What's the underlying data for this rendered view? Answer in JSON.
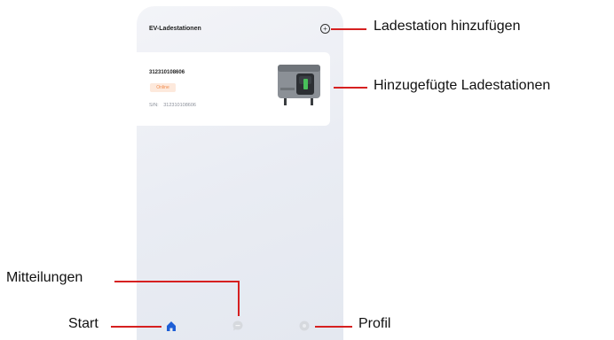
{
  "screen": {
    "title": "EV-Ladestationen",
    "add_button_icon": "plus-circle-icon"
  },
  "station_card": {
    "id": "312310108606",
    "status": "Online",
    "sn_label": "S/N:",
    "sn_value": "312310108606"
  },
  "tabbar": {
    "items": [
      {
        "icon": "home-icon",
        "active": true
      },
      {
        "icon": "message-icon",
        "active": false
      },
      {
        "icon": "profile-icon",
        "active": false
      }
    ]
  },
  "annotations": {
    "add_station": "Ladestation hinzufügen",
    "added_stations": "Hinzugefügte Ladestationen",
    "messages": "Mitteilungen",
    "start": "Start",
    "profile": "Profil"
  },
  "colors": {
    "accent": "#1e5fd6",
    "annotation_line": "#d62020",
    "status_text": "#f08a4b",
    "status_bg": "#fde9dc"
  }
}
